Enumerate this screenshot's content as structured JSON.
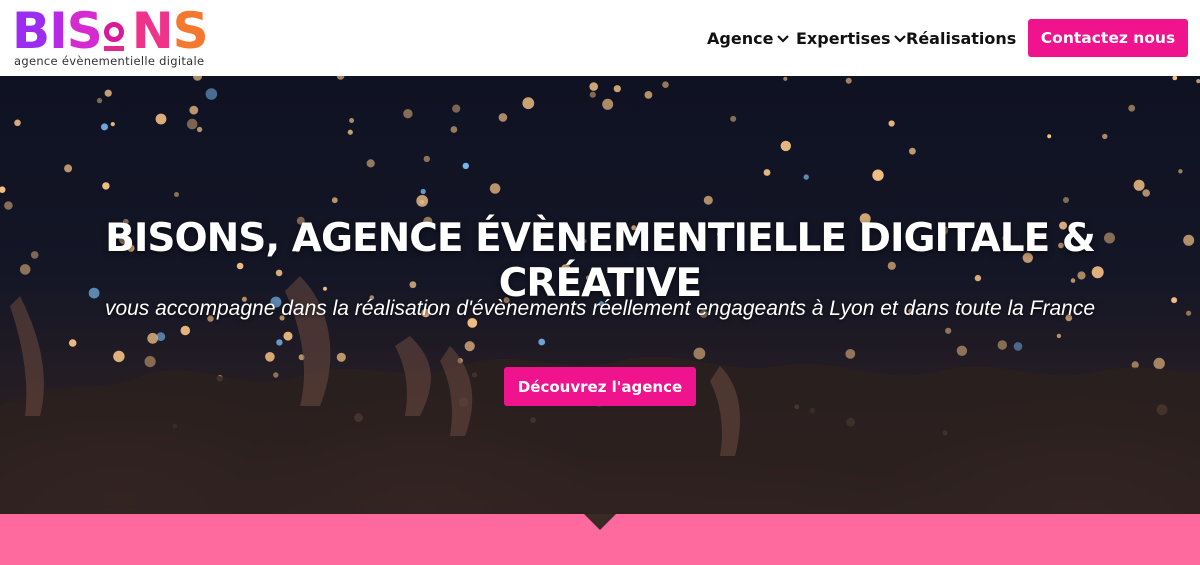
{
  "logo": {
    "letters": [
      {
        "char": "B",
        "color": "#9b2cf0"
      },
      {
        "char": "I",
        "color": "#b92ae8"
      },
      {
        "char": "S",
        "color": "#d42ad0"
      },
      {
        "char": "N",
        "color": "#f0338a"
      },
      {
        "char": "S",
        "color": "#f5782f"
      }
    ],
    "tagline": "agence évènementielle digitale"
  },
  "nav": {
    "agence": "Agence",
    "expertises": "Expertises",
    "realisations": "Réalisations",
    "chevron": "chevron-down-icon",
    "cta": "Contactez nous"
  },
  "hero": {
    "title": "BISONS, AGENCE ÉVÈNEMENTIELLE DIGITALE & CRÉATIVE",
    "subtitle": "vous accompagne dans la réalisation d'évènements réellement engageants à Lyon et dans toute la France",
    "button": "Découvrez l'agence"
  },
  "colors": {
    "accent": "#f0138e",
    "band": "#ff6a9e",
    "hero_dark": "#141626"
  }
}
